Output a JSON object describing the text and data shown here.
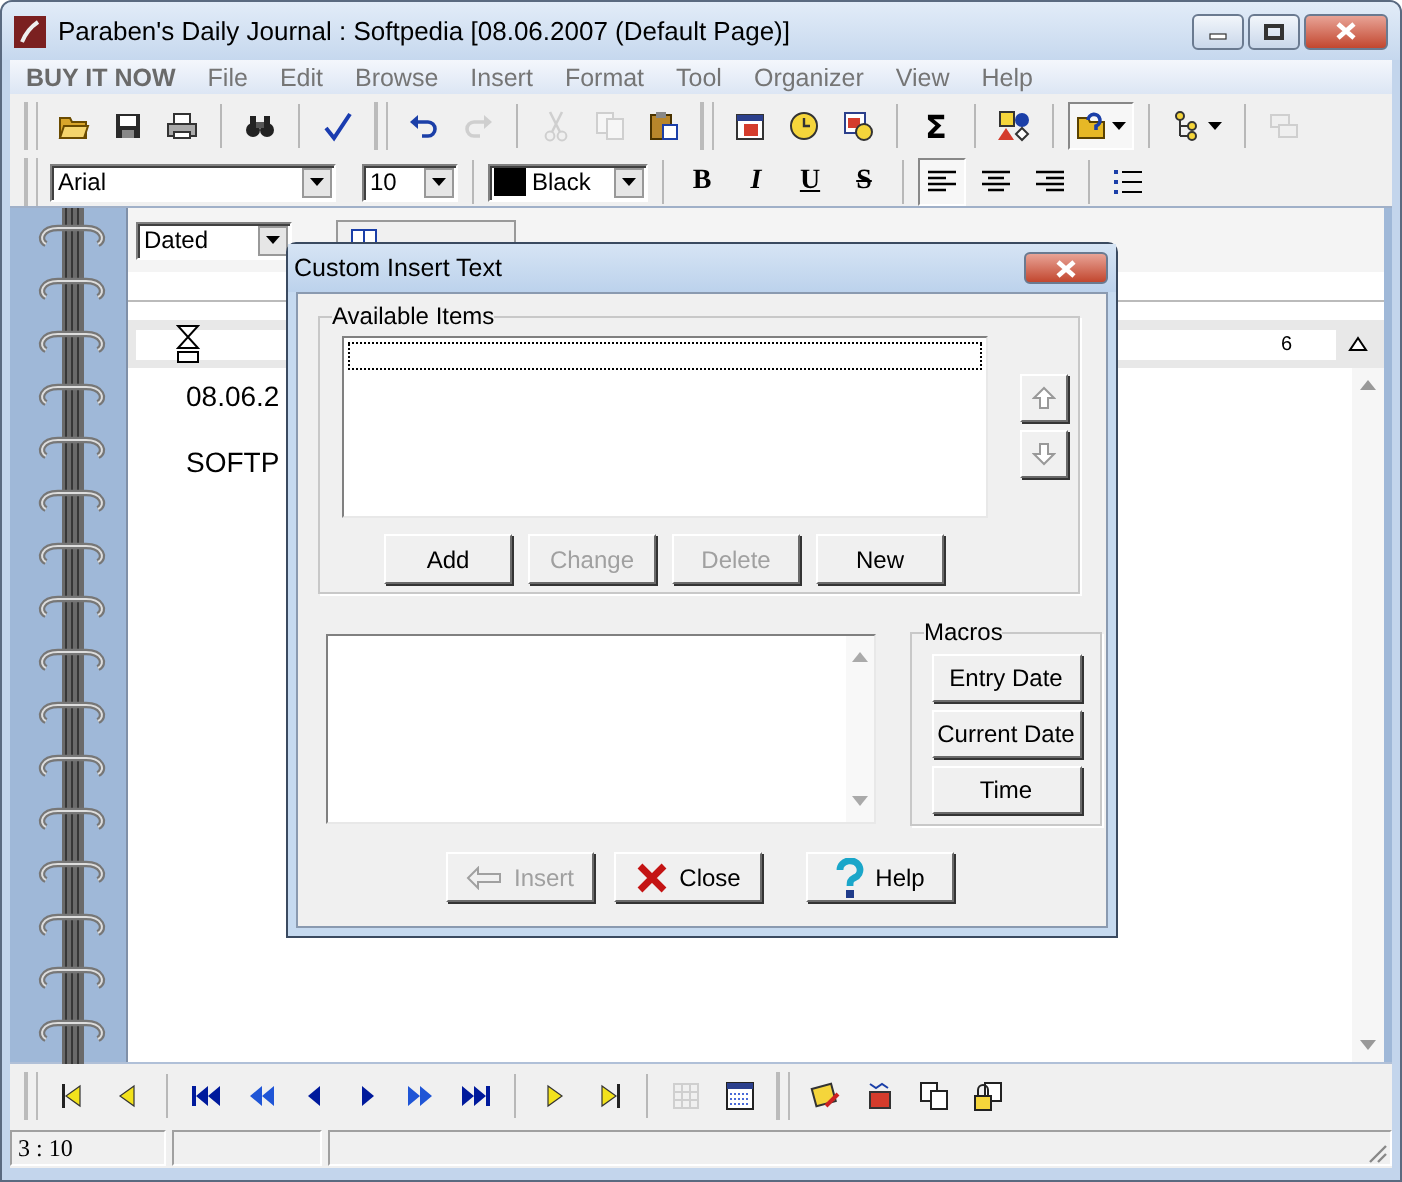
{
  "window": {
    "title": "Paraben's Daily Journal : Softpedia [08.06.2007 (Default Page)]"
  },
  "menu": [
    {
      "label": "BUY IT NOW",
      "kind": "promo"
    },
    {
      "label": "File",
      "kind": "menu"
    },
    {
      "label": "Edit",
      "kind": "menu"
    },
    {
      "label": "Browse",
      "kind": "menu"
    },
    {
      "label": "Insert",
      "kind": "menu"
    },
    {
      "label": "Format",
      "kind": "menu"
    },
    {
      "label": "Tool",
      "kind": "menu"
    },
    {
      "label": "Organizer",
      "kind": "menu"
    },
    {
      "label": "View",
      "kind": "menu"
    },
    {
      "label": "Help",
      "kind": "menu"
    }
  ],
  "toolbar": [
    {
      "kind": "grip"
    },
    {
      "kind": "open",
      "disabled": false,
      "pressed": false
    },
    {
      "kind": "save",
      "disabled": false,
      "pressed": false
    },
    {
      "kind": "print",
      "disabled": false,
      "pressed": false
    },
    {
      "kind": "separator"
    },
    {
      "kind": "find",
      "disabled": false,
      "pressed": false
    },
    {
      "kind": "separator"
    },
    {
      "kind": "spell",
      "disabled": false,
      "pressed": false
    },
    {
      "kind": "grip"
    },
    {
      "kind": "undo",
      "disabled": false,
      "pressed": false
    },
    {
      "kind": "redo",
      "disabled": true,
      "pressed": false
    },
    {
      "kind": "separator"
    },
    {
      "kind": "cut",
      "disabled": true,
      "pressed": false
    },
    {
      "kind": "copy",
      "disabled": true,
      "pressed": false
    },
    {
      "kind": "paste",
      "disabled": false,
      "pressed": false
    },
    {
      "kind": "grip"
    },
    {
      "kind": "calendar",
      "disabled": false,
      "pressed": false
    },
    {
      "kind": "clock",
      "disabled": false,
      "pressed": false
    },
    {
      "kind": "calclock",
      "disabled": false,
      "pressed": false
    },
    {
      "kind": "separator"
    },
    {
      "kind": "sum",
      "label": "Σ",
      "disabled": false,
      "pressed": false
    },
    {
      "kind": "separator"
    },
    {
      "kind": "shapes",
      "disabled": false,
      "pressed": false
    },
    {
      "kind": "separator"
    },
    {
      "kind": "folderq",
      "disabled": false,
      "pressed": true
    },
    {
      "kind": "separator"
    },
    {
      "kind": "tree",
      "disabled": false,
      "pressed": false
    },
    {
      "kind": "separator"
    },
    {
      "kind": "windows",
      "disabled": true,
      "pressed": false
    }
  ],
  "format_bar": {
    "font": "Arial",
    "size": "10",
    "color": {
      "label": "Black",
      "color": "#000000"
    },
    "styles": [
      {
        "kind": "bold",
        "label": "B"
      },
      {
        "kind": "italic",
        "label": "I"
      },
      {
        "kind": "underline",
        "label": "U"
      },
      {
        "kind": "strike",
        "label": "S"
      }
    ],
    "alignment": [
      {
        "kind": "left",
        "selected": true
      },
      {
        "kind": "center",
        "selected": false
      },
      {
        "kind": "right",
        "selected": false
      }
    ]
  },
  "page": {
    "view": "Dated",
    "ruler_label": "6",
    "lines": [
      "08.06.2",
      "SOFTP"
    ]
  },
  "dialog": {
    "title": "Custom Insert Text",
    "items_group": "Available Items",
    "item_buttons": [
      {
        "label": "Add",
        "disabled": false
      },
      {
        "label": "Change",
        "disabled": true
      },
      {
        "label": "Delete",
        "disabled": true
      },
      {
        "label": "New",
        "disabled": false
      }
    ],
    "move_buttons": [
      {
        "kind": "up",
        "disabled": true
      },
      {
        "kind": "down",
        "disabled": true
      }
    ],
    "macros_group": "Macros",
    "macros": [
      "Entry Date",
      "Current Date",
      "Time"
    ],
    "actions": [
      {
        "kind": "insert",
        "label": "Insert",
        "disabled": true
      },
      {
        "kind": "close",
        "label": "Close",
        "disabled": false
      },
      {
        "kind": "help",
        "label": "Help",
        "disabled": false
      }
    ]
  },
  "nav_toolbar": [
    {
      "kind": "grip"
    },
    {
      "kind": "entry-first",
      "disabled": false
    },
    {
      "kind": "entry-prev",
      "disabled": false
    },
    {
      "kind": "separator"
    },
    {
      "kind": "page-first",
      "disabled": false
    },
    {
      "kind": "page-rewind",
      "disabled": false
    },
    {
      "kind": "page-prev",
      "disabled": false
    },
    {
      "kind": "page-next",
      "disabled": false
    },
    {
      "kind": "page-ffwd",
      "disabled": false
    },
    {
      "kind": "page-last",
      "disabled": false
    },
    {
      "kind": "separator"
    },
    {
      "kind": "entry-next",
      "disabled": false
    },
    {
      "kind": "entry-last",
      "disabled": false
    },
    {
      "kind": "separator"
    },
    {
      "kind": "grid",
      "disabled": true
    },
    {
      "kind": "calendar-grid",
      "disabled": false
    },
    {
      "kind": "grip"
    },
    {
      "kind": "note",
      "disabled": false
    },
    {
      "kind": "stamp",
      "disabled": false
    },
    {
      "kind": "pages",
      "disabled": false
    },
    {
      "kind": "lock",
      "disabled": false
    }
  ],
  "status_bar": {
    "position": "3 : 10"
  }
}
